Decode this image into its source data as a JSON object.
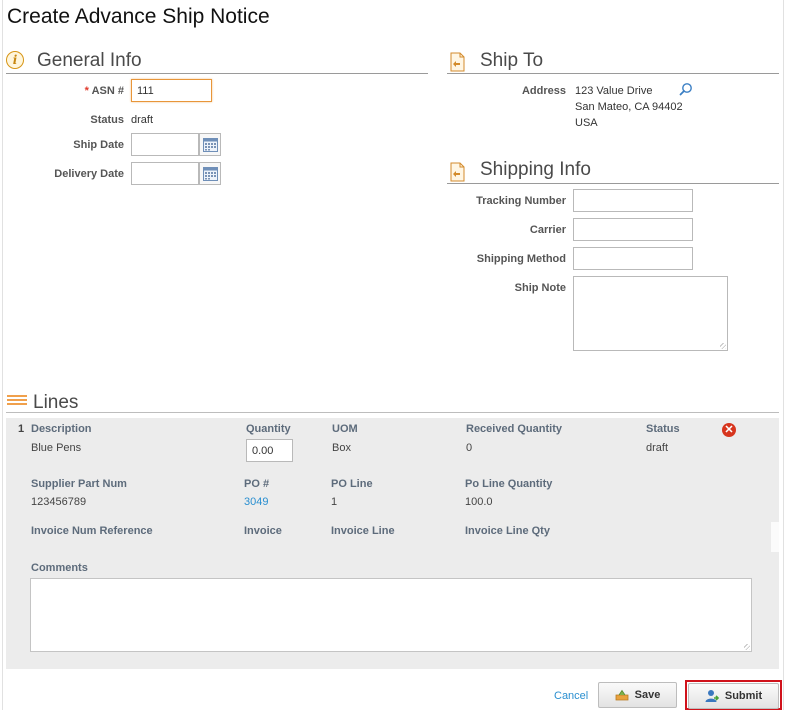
{
  "page": {
    "title": "Create Advance Ship Notice"
  },
  "general_info": {
    "title": "General Info",
    "icon": "info-icon",
    "asn_label": "ASN #",
    "asn_required_mark": "*",
    "asn_value": "111",
    "status_label": "Status",
    "status_value": "draft",
    "ship_date_label": "Ship Date",
    "ship_date_value": "",
    "delivery_date_label": "Delivery Date",
    "delivery_date_value": ""
  },
  "ship_to": {
    "title": "Ship To",
    "address_label": "Address",
    "address_lines": [
      "123 Value Drive",
      "San Mateo, CA 94402",
      "USA"
    ]
  },
  "shipping_info": {
    "title": "Shipping Info",
    "tracking_number_label": "Tracking Number",
    "tracking_number_value": "",
    "carrier_label": "Carrier",
    "carrier_value": "",
    "shipping_method_label": "Shipping Method",
    "shipping_method_value": "",
    "ship_note_label": "Ship Note",
    "ship_note_value": ""
  },
  "lines": {
    "title": "Lines",
    "item": {
      "line_number": "1",
      "headers": {
        "description": "Description",
        "quantity": "Quantity",
        "uom": "UOM",
        "received_quantity": "Received Quantity",
        "status": "Status",
        "supplier_part_num": "Supplier Part Num",
        "po_number": "PO #",
        "po_line": "PO Line",
        "po_line_quantity": "Po Line Quantity",
        "invoice_num_reference": "Invoice Num Reference",
        "invoice": "Invoice",
        "invoice_line": "Invoice Line",
        "invoice_line_qty": "Invoice Line Qty",
        "comments": "Comments"
      },
      "values": {
        "description": "Blue Pens",
        "quantity": "0.00",
        "uom": "Box",
        "received_quantity": "0",
        "status": "draft",
        "supplier_part_num": "123456789",
        "po_number": "3049",
        "po_line": "1",
        "po_line_quantity": "100.0",
        "comments": ""
      }
    }
  },
  "actions": {
    "cancel_label": "Cancel",
    "save_label": "Save",
    "submit_label": "Submit"
  },
  "colors": {
    "accent_orange": "#f0a04c",
    "link_blue": "#2a8fd0",
    "required_red": "#e0392b",
    "highlight_red": "#d0121b"
  }
}
